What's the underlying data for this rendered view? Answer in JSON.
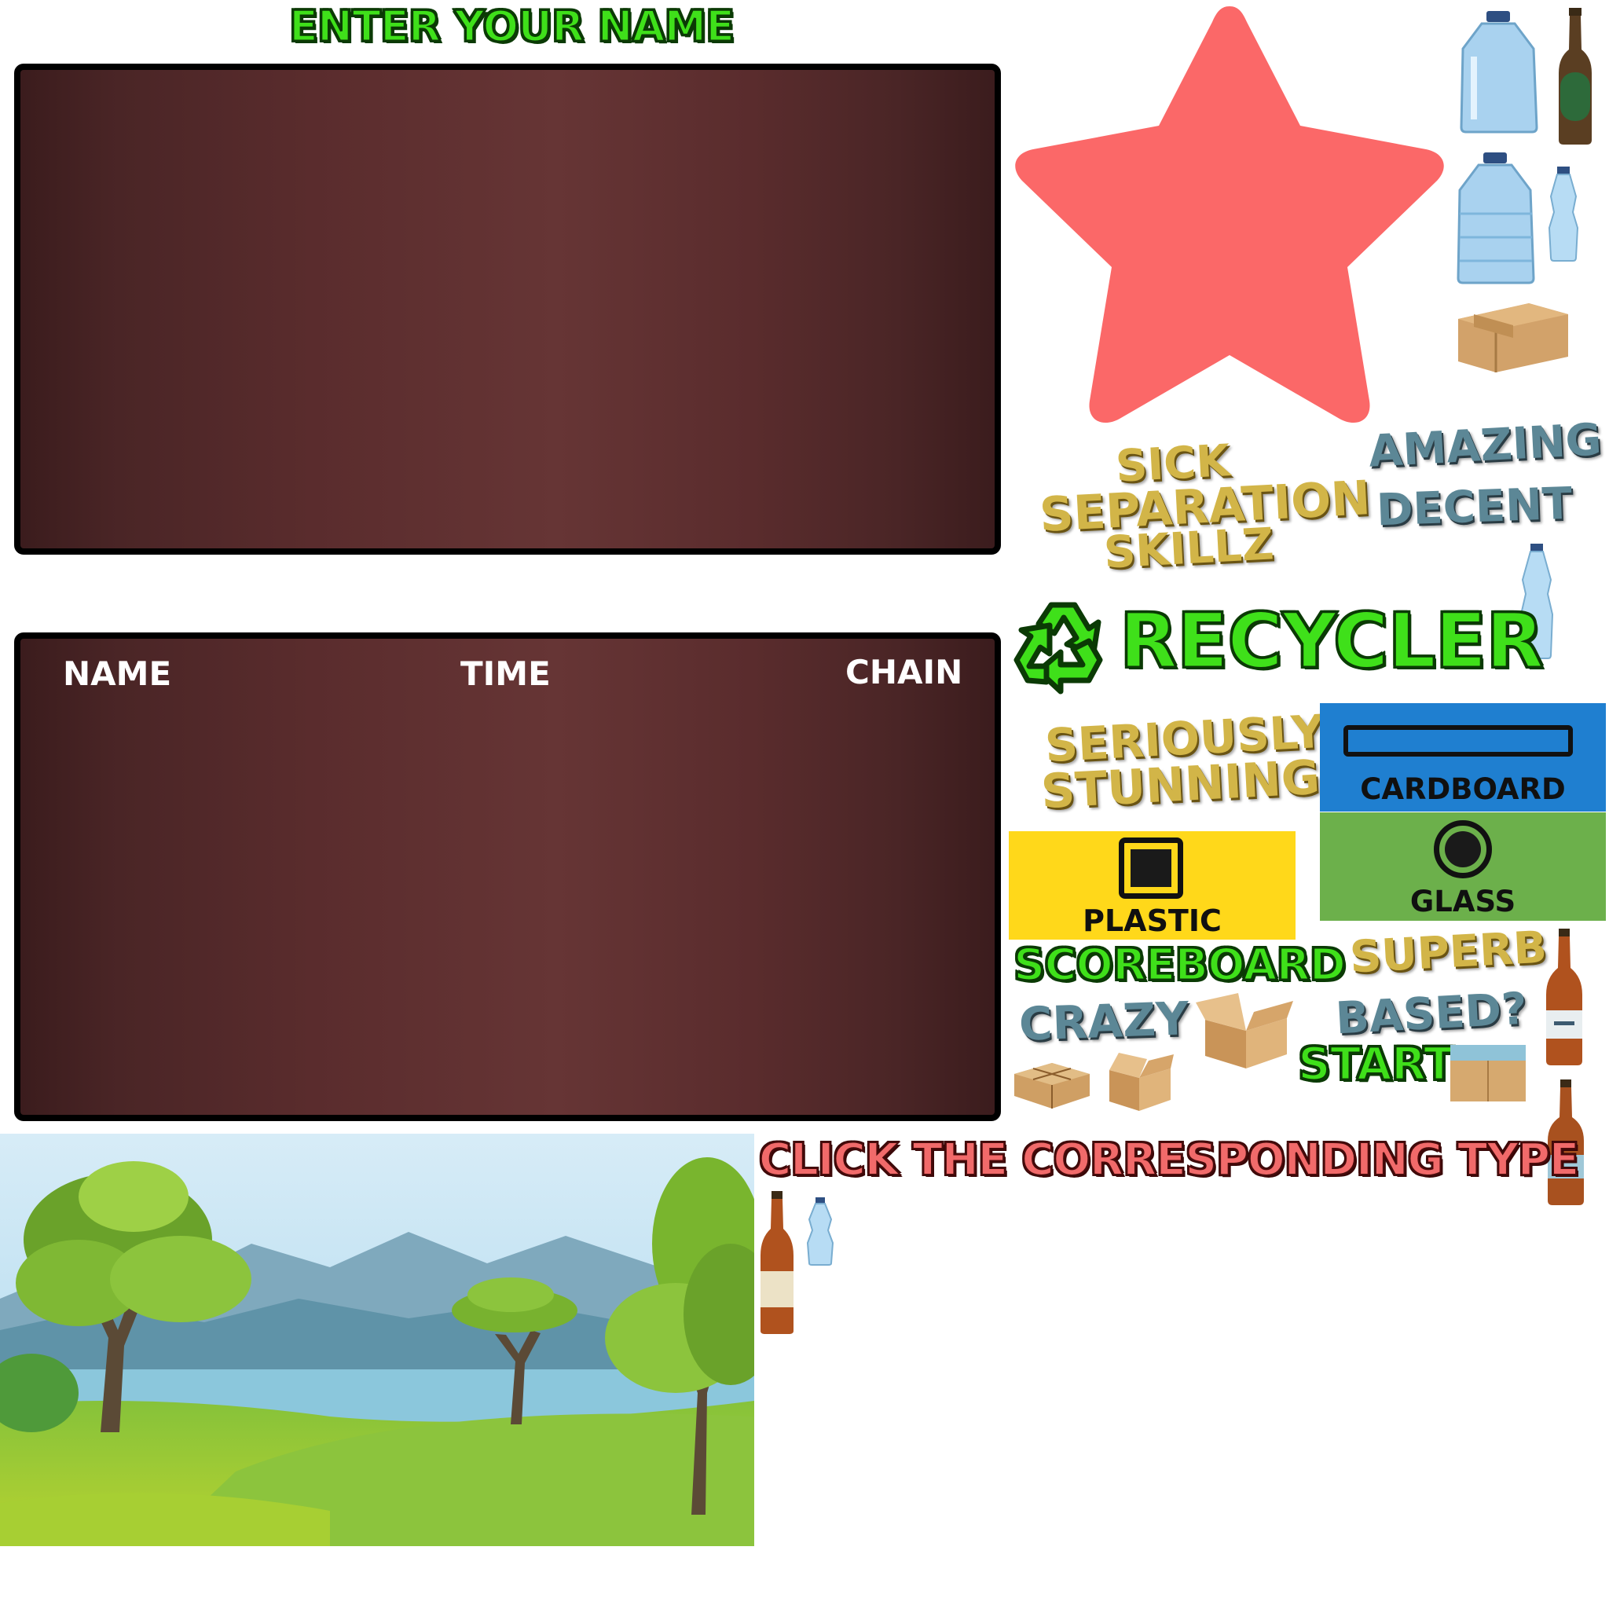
{
  "name_entry": {
    "title": "ENTER YOUR NAME"
  },
  "scoreboard_panel": {
    "columns": {
      "name": "NAME",
      "time": "TIME",
      "chain": "CHAIN"
    }
  },
  "labels": {
    "recycler": "RECYCLER",
    "scoreboard": "SCOREBOARD",
    "start": "START",
    "instruction": "CLICK THE CORRESPONDING TYPE"
  },
  "ratings": {
    "sick": [
      "SICK",
      "SEPARATION",
      "SKILLZ"
    ],
    "amazing": "AMAZING",
    "decent": "DECENT",
    "stunning": [
      "SERIOUSLY",
      "STUNNING"
    ],
    "superb": "SUPERB",
    "crazy": "CRAZY",
    "based": "BASED?"
  },
  "bins": {
    "cardboard": {
      "label": "CARDBOARD",
      "color": "#1f7fd0"
    },
    "plastic": {
      "label": "PLASTIC",
      "color": "#ffd81a"
    },
    "glass": {
      "label": "GLASS",
      "color": "#6cb04b"
    }
  },
  "icons": [
    "star-icon",
    "recycle-icon",
    "water-jug-icon",
    "green-glass-bottle-icon",
    "plastic-bottle-icon",
    "brown-beer-bottle-icon",
    "cardboard-box-icon",
    "open-box-icon",
    "wrapped-parcel-icon"
  ]
}
